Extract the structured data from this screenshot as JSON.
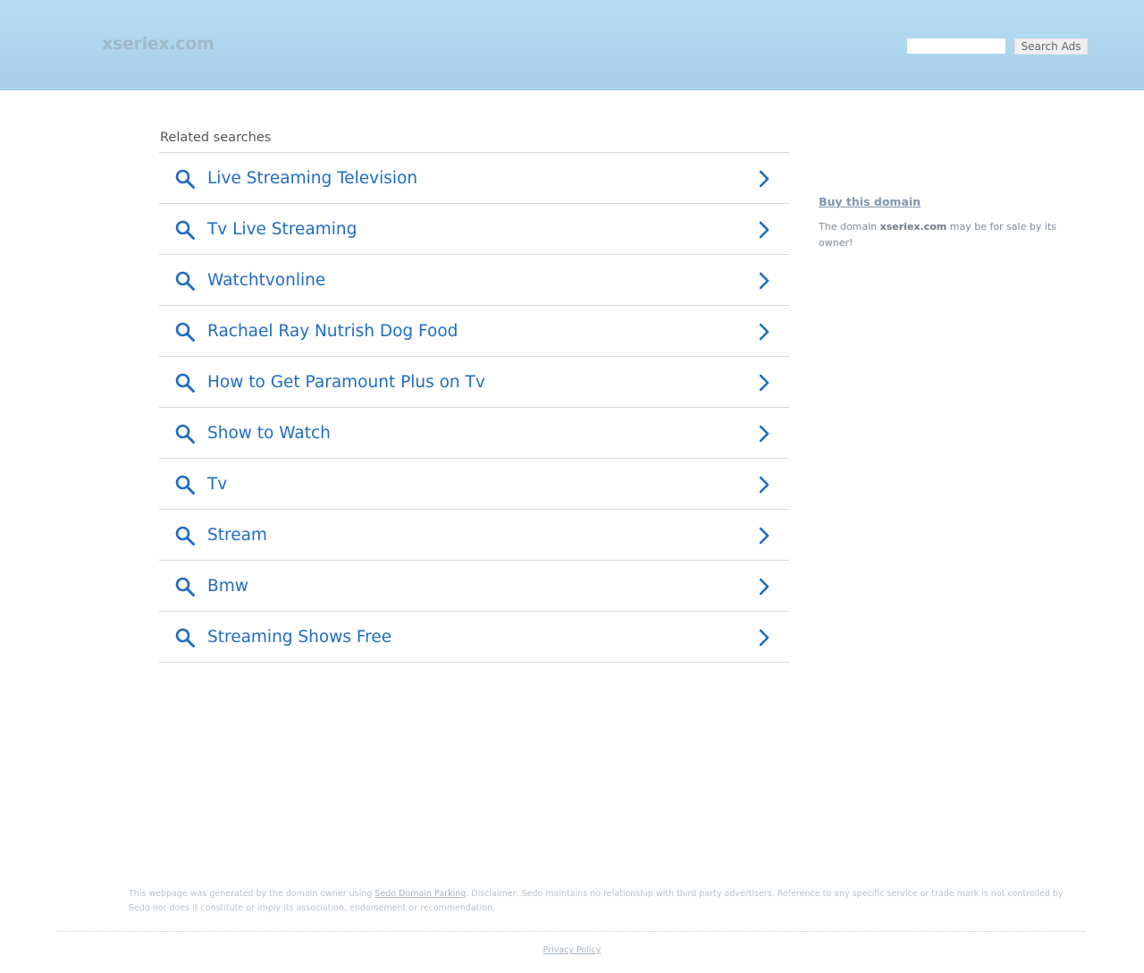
{
  "header": {
    "logo": "xseriex.com",
    "search_value": "",
    "search_button_label": "Search Ads"
  },
  "related": {
    "title": "Related searches",
    "items": [
      {
        "label": "Live Streaming Television"
      },
      {
        "label": "Tv Live Streaming"
      },
      {
        "label": "Watchtvonline"
      },
      {
        "label": "Rachael Ray Nutrish Dog Food"
      },
      {
        "label": "How to Get Paramount Plus on Tv"
      },
      {
        "label": "Show to Watch"
      },
      {
        "label": "Tv"
      },
      {
        "label": "Stream"
      },
      {
        "label": "Bmw"
      },
      {
        "label": "Streaming Shows Free"
      }
    ]
  },
  "sidebar": {
    "buy_link": "Buy this domain",
    "text_before": "The domain ",
    "domain": "xseriex.com",
    "text_after": " may be for sale by its owner!"
  },
  "footer": {
    "disclaimer_before": "This webpage was generated by the domain owner using ",
    "disclaimer_link": "Sedo Domain Parking",
    "disclaimer_after": ". Disclaimer: Sedo maintains no relationship with third party advertisers. Reference to any specific service or trade mark is not controlled by Sedo nor does it constitute or imply its association, endorsement or recommendation.",
    "privacy_link": "Privacy Policy"
  },
  "colors": {
    "link_blue": "#1f6cc2",
    "header_gradient_top": "#b5def3",
    "header_gradient_bottom": "#a7cfe8"
  },
  "icons": {
    "row_leading": "search-icon",
    "row_trailing": "chevron-right-icon"
  }
}
